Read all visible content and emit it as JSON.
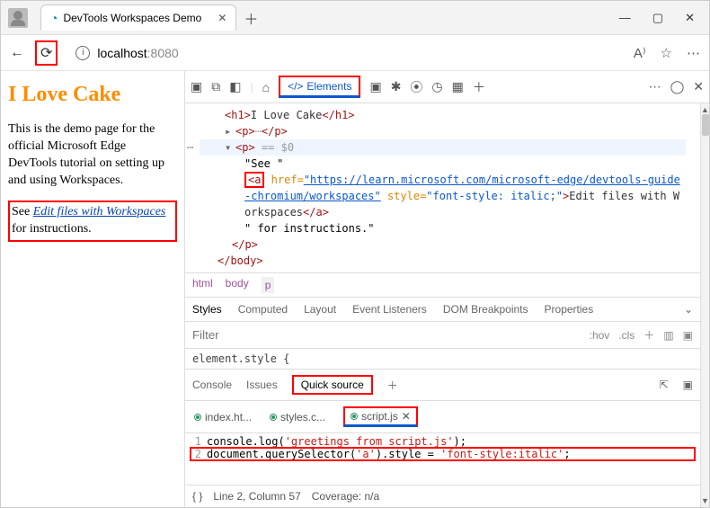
{
  "browser": {
    "tab_title": "DevTools Workspaces Demo",
    "url_host": "localhost",
    "url_port": ":8080"
  },
  "page": {
    "heading": "I Love Cake",
    "intro": "This is the demo page for the official Microsoft Edge DevTools tutorial on setting up and using Workspaces.",
    "see_prefix": "See ",
    "link_text": "Edit files with Workspaces",
    "see_suffix": " for instructions."
  },
  "devtools": {
    "elements_label": "Elements",
    "dom": {
      "h1_open": "<h1>",
      "h1_text": "I Love Cake",
      "h1_close": "</h1>",
      "p_open": "<p>",
      "p_close": "</p>",
      "eq0": "== $0",
      "see_txt": "\"See \"",
      "a_open": "<a",
      "href_attr": " href=",
      "href_val": "\"https://learn.microsoft.com/microsoft-edge/devtools-guide-chromium/workspaces\"",
      "style_attr": " style=",
      "style_val": "\"font-style: italic;\"",
      "a_gt": ">",
      "a_text": "Edit files with Workspaces",
      "a_close": "</a>",
      "instr_txt": "\" for instructions.\"",
      "body_close": "</body>"
    },
    "breadcrumb": {
      "html": "html",
      "body": "body",
      "p": "p"
    },
    "styles_tabs": {
      "styles": "Styles",
      "computed": "Computed",
      "layout": "Layout",
      "evt": "Event Listeners",
      "domb": "DOM Breakpoints",
      "props": "Properties"
    },
    "filter_placeholder": "Filter",
    "hov_label": ":hov",
    "cls_label": ".cls",
    "element_style": "element.style {",
    "drawer": {
      "console": "Console",
      "issues": "Issues",
      "quick": "Quick source"
    },
    "files": {
      "index": "index.ht...",
      "styles": "styles.c...",
      "script": "script.js"
    },
    "code": {
      "l1_a": "console.log(",
      "l1_s": "'greetings from script.js'",
      "l1_b": ");",
      "l2_a": "document.querySelector(",
      "l2_s1": "'a'",
      "l2_b": ").style = ",
      "l2_s2": "'font-style:italic'",
      "l2_c": ";"
    },
    "status": {
      "brace": "{ }",
      "pos": "Line 2, Column 57",
      "cov": "Coverage: n/a"
    }
  }
}
